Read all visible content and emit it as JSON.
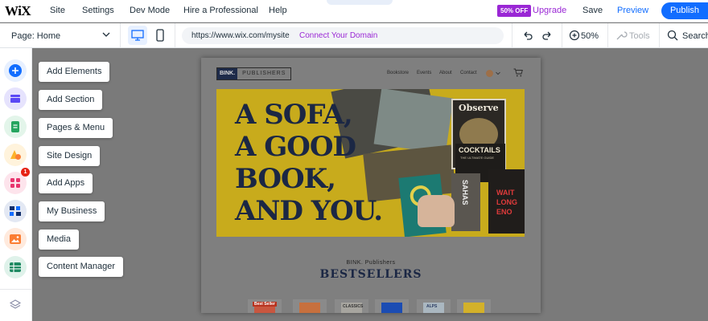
{
  "topbar": {
    "logo": "WiX",
    "menu": [
      "Site",
      "Settings",
      "Dev Mode",
      "Hire a Professional",
      "Help"
    ],
    "sale_badge": "50% OFF",
    "upgrade": "Upgrade",
    "save": "Save",
    "preview": "Preview",
    "publish": "Publish"
  },
  "secondbar": {
    "page_label": "Page: Home",
    "url": "https://www.wix.com/mysite",
    "connect_domain": "Connect Your Domain",
    "zoom": "50%",
    "tools": "Tools",
    "search": "Search"
  },
  "rail": {
    "items": [
      {
        "label": "Add Elements",
        "icon": "plus-icon",
        "color": "#116dff"
      },
      {
        "label": "Add Section",
        "icon": "section-icon",
        "color": "#5a48f5"
      },
      {
        "label": "Pages & Menu",
        "icon": "page-icon",
        "color": "#25a55f"
      },
      {
        "label": "Site Design",
        "icon": "design-icon",
        "color": "#fdb32a"
      },
      {
        "label": "Add Apps",
        "icon": "apps-icon",
        "color": "#e8356e"
      },
      {
        "label": "My Business",
        "icon": "business-icon",
        "color": "#0f2d6b"
      },
      {
        "label": "Media",
        "icon": "media-icon",
        "color": "#fb7d33"
      },
      {
        "label": "Content Manager",
        "icon": "database-icon",
        "color": "#1e8a62"
      }
    ],
    "apps_badge": "1"
  },
  "site": {
    "logo_left": "BINK.",
    "logo_right": "PUBLISHERS",
    "nav": [
      "Bookstore",
      "Events",
      "About",
      "Contact"
    ],
    "hero_lines": [
      "A SOFA,",
      "A GOOD",
      "BOOK,",
      "AND YOU."
    ],
    "book_observe": "Observe",
    "book_cocktails": "COCKTAILS",
    "book_cocktails_sub": "THE ULTIMATE GUIDE",
    "book_sahas": "SAHAS",
    "book_wait": "WAIT",
    "book_long": "LONG",
    "book_eno": "ENO",
    "small_title": "BINK. Publishers",
    "section_title": "BESTSELLERS",
    "thumb_texts": [
      "Best Seller",
      "",
      "CLASSICS",
      "",
      "ALPS",
      ""
    ]
  },
  "colors": {
    "accent": "#116dff",
    "upgrade": "#9a27d5",
    "hero_yellow": "#c8ab1c",
    "navy": "#1b2744"
  }
}
